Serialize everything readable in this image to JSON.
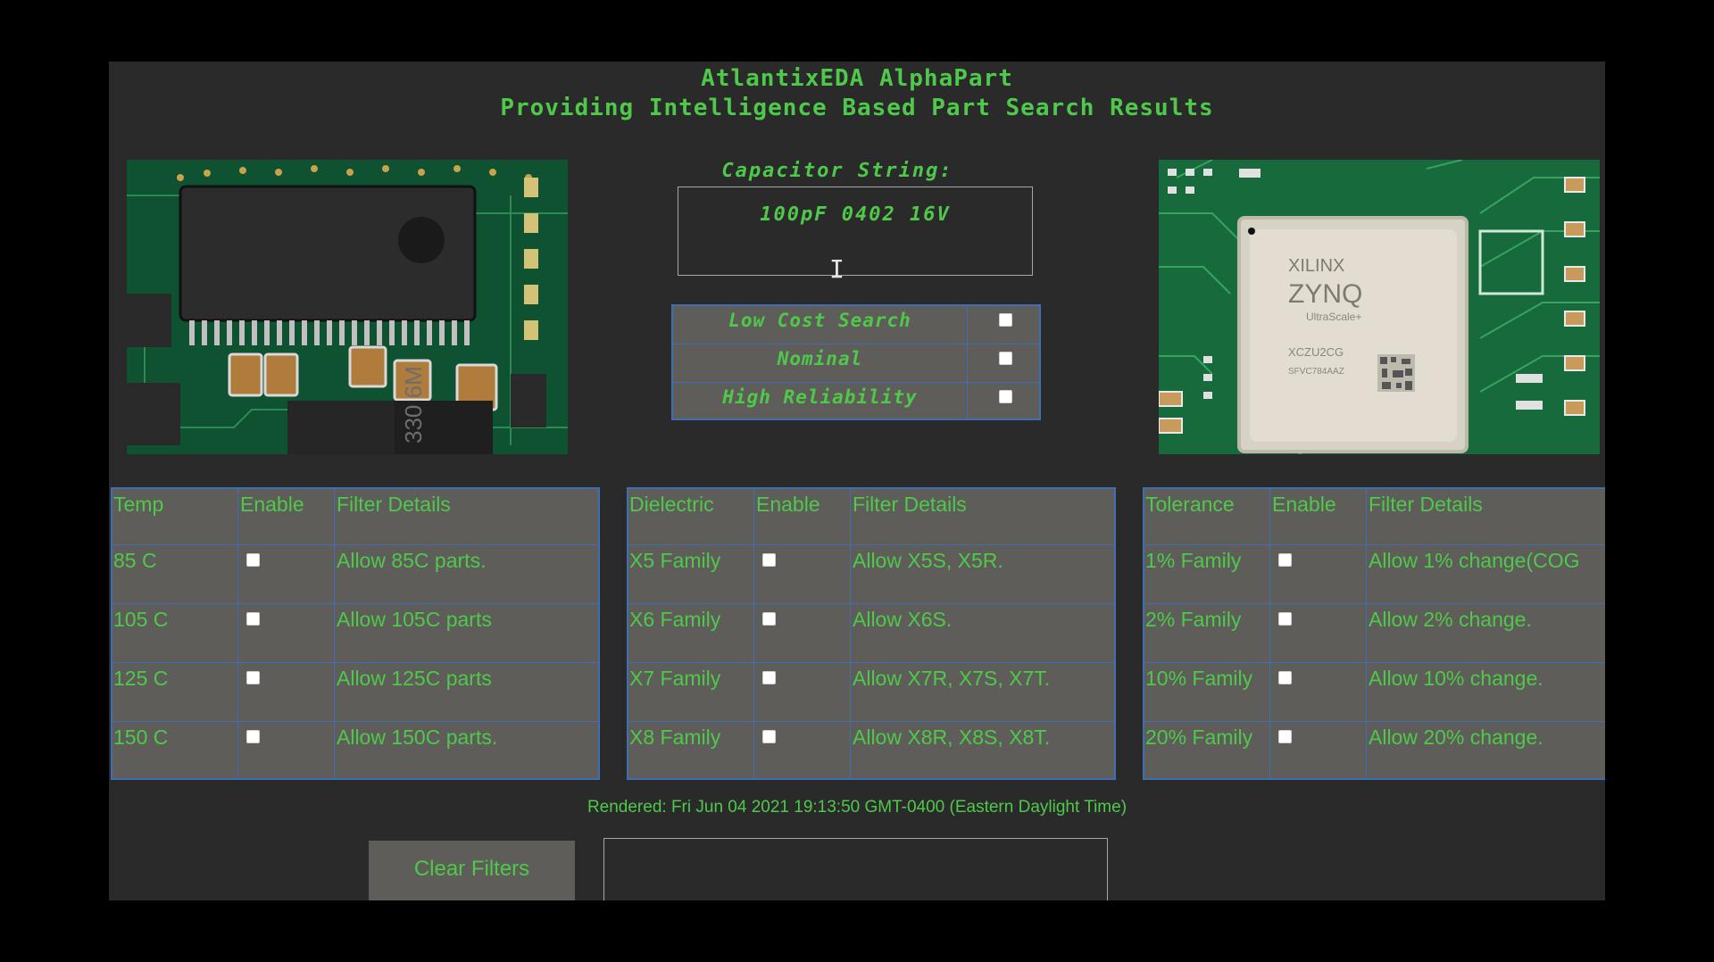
{
  "header": {
    "title": "AtlantixEDA AlphaPart",
    "subtitle": "Providing Intelligence Based Part Search Results"
  },
  "capacitor": {
    "label": "Capacitor String:",
    "value": "100pF 0402 16V"
  },
  "modes": [
    {
      "label": "Low Cost Search",
      "checked": false
    },
    {
      "label": "Nominal",
      "checked": false
    },
    {
      "label": "High Reliability",
      "checked": false
    }
  ],
  "temp_table": {
    "headers": [
      "Temp",
      "Enable",
      "Filter Details"
    ],
    "rows": [
      {
        "name": "85 C",
        "detail": "Allow 85C parts."
      },
      {
        "name": "105 C",
        "detail": "Allow 105C parts"
      },
      {
        "name": "125 C",
        "detail": "Allow 125C parts"
      },
      {
        "name": "150 C",
        "detail": "Allow 150C parts."
      }
    ]
  },
  "dielectric_table": {
    "headers": [
      "Dielectric",
      "Enable",
      "Filter Details"
    ],
    "rows": [
      {
        "name": "X5 Family",
        "detail": "Allow X5S, X5R."
      },
      {
        "name": "X6 Family",
        "detail": "Allow X6S."
      },
      {
        "name": "X7 Family",
        "detail": "Allow X7R, X7S, X7T."
      },
      {
        "name": "X8 Family",
        "detail": "Allow X8R, X8S, X8T."
      }
    ]
  },
  "tolerance_table": {
    "headers": [
      "Tolerance",
      "Enable",
      "Filter Details"
    ],
    "rows": [
      {
        "name": "1% Family",
        "detail": "Allow 1% change(COG"
      },
      {
        "name": "2% Family",
        "detail": "Allow 2% change."
      },
      {
        "name": "10% Family",
        "detail": "Allow 10% change."
      },
      {
        "name": "20% Family",
        "detail": "Allow 20% change."
      }
    ]
  },
  "chip": {
    "brand": "XILINX",
    "product": "ZYNQ",
    "series": "UltraScale+",
    "part": "XCZU2CG",
    "package": "SFVC784AAZ"
  },
  "board_label": "330 6M",
  "rendered": "Rendered: Fri Jun 04 2021 19:13:50 GMT-0400 (Eastern Daylight Time)",
  "clear_button": "Clear Filters",
  "colors": {
    "accent": "#4ec94a",
    "panel": "#2b2a2b",
    "table": "#5f5d59",
    "border": "#3f6fb3"
  }
}
